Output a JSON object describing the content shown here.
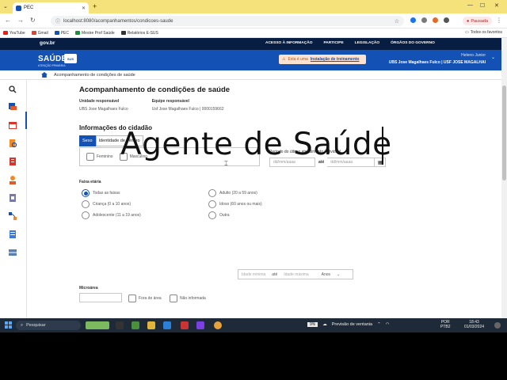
{
  "browser": {
    "tab_title": "PEC",
    "url": "localhost:8080/acompanhamentos/condicoes-saude",
    "paused_label": "Pausada",
    "bookmarks": [
      {
        "label": "YouTube",
        "color": "#e62117"
      },
      {
        "label": "Gmail",
        "color": "#d44638"
      },
      {
        "label": "PEC",
        "color": "#1351b4"
      },
      {
        "label": "Mestre Prof Saúde",
        "color": "#1c8f3c"
      },
      {
        "label": "Relatórios E-SUS",
        "color": "#333333"
      }
    ],
    "all_bookmarks": "Todos os favoritos"
  },
  "gov": {
    "logo": "gov.br",
    "links": [
      "ACESSO À INFORMAÇÃO",
      "PARTICIPE",
      "LEGISLAÇÃO",
      "ÓRGÃOS DO GOVERNO"
    ]
  },
  "app": {
    "brand": "SAÚDE",
    "brand_badge": "SUS",
    "brand_sub": "ATENÇÃO PRIMÁRIA",
    "env_prefix": "Esta é uma",
    "env_link": "Instalação de treinamento",
    "user_name": "Heleno Junior",
    "user_unit": "UBS Jose Magalhaes Fulco | USF JOSE MAGALHAI",
    "breadcrumb": "Acompanhamento de condições de saúde"
  },
  "page": {
    "title": "Acompanhamento de condições de saúde",
    "unit_label": "Unidade responsável",
    "unit_value": "UBS Jose Magalhaes Fulco",
    "team_label": "Equipe responsável",
    "team_value": "Usf Jose Magalhaes Fulco | 0000159662",
    "section_title": "Informações do cidadão",
    "seg_tabs": [
      "Sexo",
      "Identidade de gênero"
    ],
    "sex_options": [
      "Feminino",
      "Masculino"
    ],
    "period_label": "Período do último atendimento individual",
    "date_placeholder": "dd/mm/aaaa",
    "date_sep": "até",
    "age_label": "Faixa etária",
    "age_left": [
      "Todas as faixas",
      "Criança (0 a 10 anos)",
      "Adolescente (11 a 19 anos)"
    ],
    "age_right": [
      "Adulto (20 a 59 anos)",
      "Idoso (60 anos ou mais)",
      "Outra"
    ],
    "age_min_placeholder": "Idade mínima",
    "age_max_placeholder": "Idade máxima",
    "age_unit": "Anos",
    "micro_label": "Microárea",
    "micro_options": [
      "Fora de área",
      "Não informada"
    ]
  },
  "overlay_text": "Agente de Saúde",
  "taskbar": {
    "search": "Pesquisar",
    "battery": "9%",
    "weather": "Previsão de ventania",
    "lang1": "POR",
    "lang2": "PTB2",
    "time": "18:43",
    "date": "01/03/2024"
  },
  "colors": {
    "primary": "#1351b4",
    "gov": "#071d41",
    "tabstrip": "#f5e27a"
  }
}
